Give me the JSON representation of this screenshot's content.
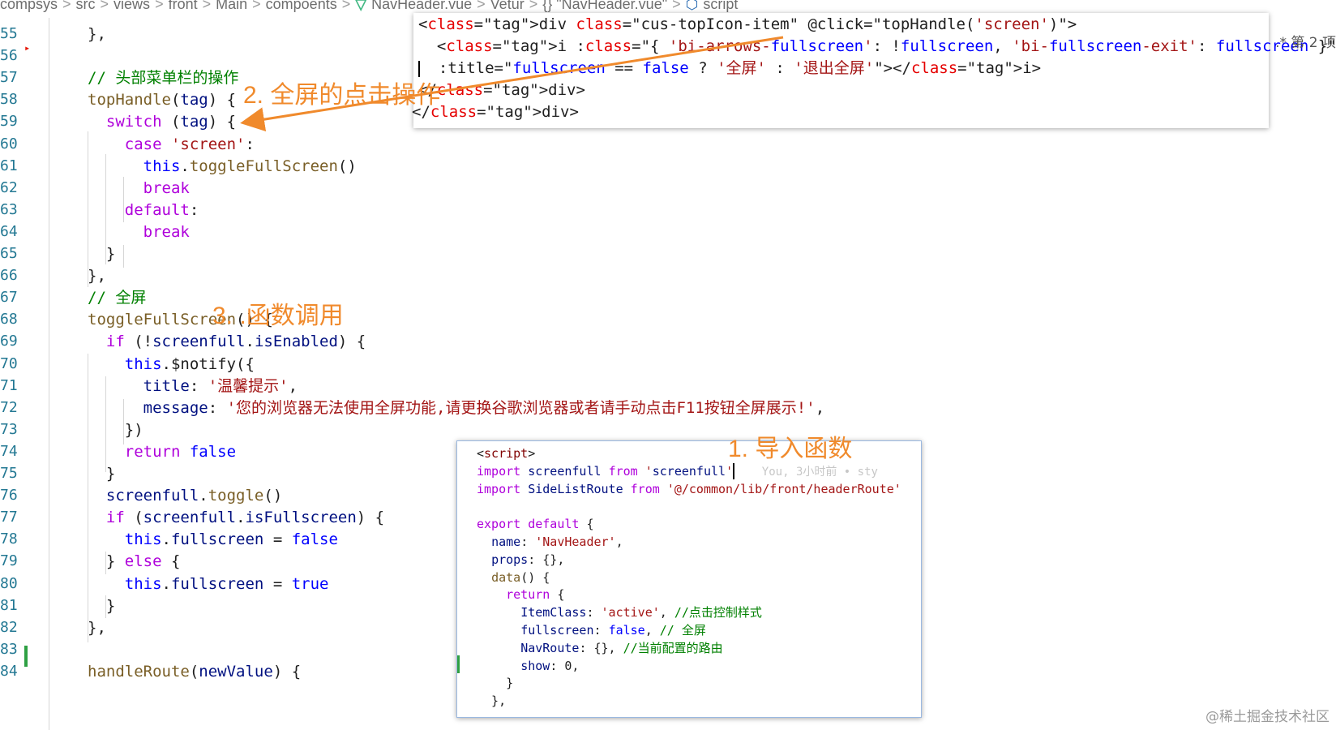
{
  "breadcrumb": {
    "items": [
      "compsys",
      "src",
      "views",
      "front",
      "Main",
      "compoents",
      "NavHeader.vue",
      "Vetur",
      "{} \"NavHeader.vue\"",
      "script"
    ],
    "separator": ">",
    "file_icon": "vue-icon",
    "script_icon": "cube-icon"
  },
  "editor": {
    "lines": [
      {
        "n": "55",
        "t": "},"
      },
      {
        "n": "56",
        "t": ""
      },
      {
        "n": "57",
        "t": "// 头部菜单栏的操作"
      },
      {
        "n": "58",
        "t": "topHandle(tag) {"
      },
      {
        "n": "59",
        "t": "  switch (tag) {"
      },
      {
        "n": "60",
        "t": "    case 'screen':"
      },
      {
        "n": "61",
        "t": "      this.toggleFullScreen()"
      },
      {
        "n": "62",
        "t": "      break"
      },
      {
        "n": "63",
        "t": "    default:"
      },
      {
        "n": "64",
        "t": "      break"
      },
      {
        "n": "65",
        "t": "  }"
      },
      {
        "n": "66",
        "t": "},"
      },
      {
        "n": "67",
        "t": "// 全屏"
      },
      {
        "n": "68",
        "t": "toggleFullScreen() {"
      },
      {
        "n": "69",
        "t": "  if (!screenfull.isEnabled) {"
      },
      {
        "n": "70",
        "t": "    this.$notify({"
      },
      {
        "n": "71",
        "t": "      title: '温馨提示',"
      },
      {
        "n": "72",
        "t": "      message: '您的浏览器无法使用全屏功能,请更换谷歌浏览器或者请手动点击F11按钮全屏展示!',"
      },
      {
        "n": "73",
        "t": "    })"
      },
      {
        "n": "74",
        "t": "    return false"
      },
      {
        "n": "75",
        "t": "  }"
      },
      {
        "n": "76",
        "t": "  screenfull.toggle()"
      },
      {
        "n": "77",
        "t": "  if (screenfull.isFullscreen) {"
      },
      {
        "n": "78",
        "t": "    this.fullscreen = false"
      },
      {
        "n": "79",
        "t": "  } else {"
      },
      {
        "n": "80",
        "t": "    this.fullscreen = true"
      },
      {
        "n": "81",
        "t": "  }"
      },
      {
        "n": "82",
        "t": "},"
      },
      {
        "n": "83",
        "t": ""
      },
      {
        "n": "84",
        "t": "handleRoute(newValue) {"
      }
    ]
  },
  "overlay_top": {
    "lines": [
      "<div class=\"cus-topIcon-item\" @click=\"topHandle('screen')\">",
      "  <i :class=\"{ 'bi-arrows-fullscreen': !fullscreen, 'bi-fullscreen-exit': fullscreen }\"",
      "  :title=\"fullscreen == false ? '全屏' : '退出全屏'\"></i>",
      "</div>",
      "</div>"
    ]
  },
  "overlay_bottom": {
    "lines": [
      "<script>",
      "import screenfull from 'screenfull'",
      "import SideListRoute from '@/common/lib/front/headerRoute'",
      "",
      "export default {",
      "  name: 'NavHeader',",
      "  props: {},",
      "  data() {",
      "    return {",
      "      ItemClass: 'active', //点击控制样式",
      "      fullscreen: false, // 全屏",
      "      NavRoute: {}, //当前配置的路由",
      "      show: 0,",
      "    }",
      "  },"
    ],
    "blame": "You, 3小时前 • sty"
  },
  "annotations": {
    "a1": "1. 导入函数",
    "a2": "2. 全屏的点击操作",
    "a3": "3. .函数调用"
  },
  "right_edge": ".*  第 2 项",
  "watermark": "@稀土掘金技术社区",
  "colors": {
    "annotation": "#f08a2c",
    "keyword": "#0000ff",
    "control": "#af00db",
    "string": "#a31515",
    "variable": "#001080",
    "function": "#795e26"
  }
}
